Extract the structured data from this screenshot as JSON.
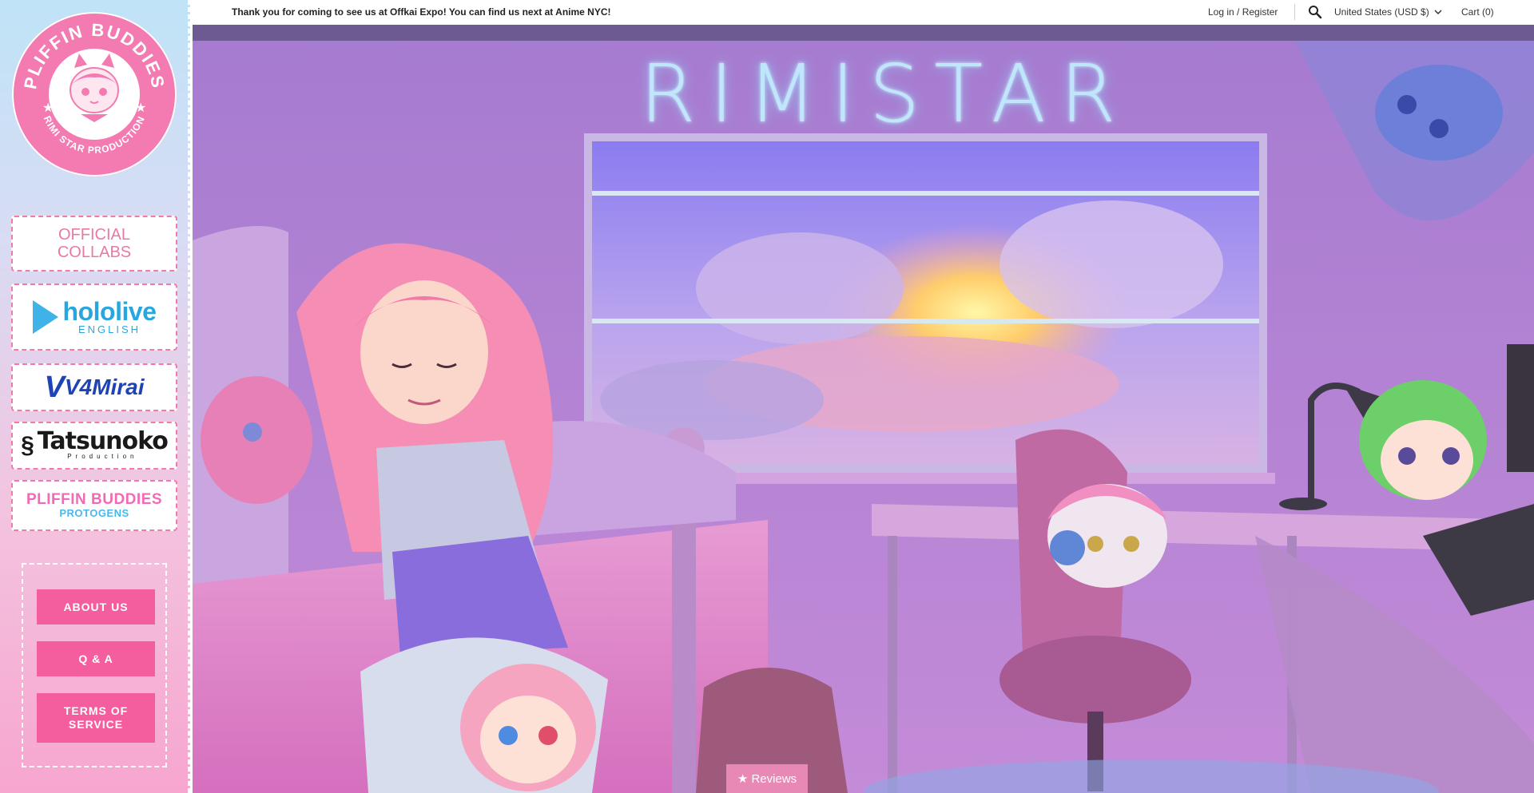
{
  "sidebar": {
    "logo": {
      "brand": "PLIFFIN BUDDIES",
      "subtitle": "RIMI STAR PRODUCTION"
    },
    "official_collabs_label": "OFFICIAL COLLABS",
    "partners": {
      "hololive": {
        "main": "hololive",
        "sub": "ENGLISH"
      },
      "v4mirai": {
        "mark": "V",
        "main": "V4Mirai"
      },
      "tatsunoko": {
        "main": "Tatsunoko",
        "sub": "Production"
      },
      "protogens": {
        "main": "PLIFFIN BUDDIES",
        "sub": "PROTOGENS"
      }
    },
    "info_buttons": {
      "about": "ABOUT US",
      "qa": "Q & A",
      "terms": "TERMS OF SERVICE"
    }
  },
  "header": {
    "announcement": "Thank you for coming to see us at Offkai Expo! You can find us next at Anime NYC!",
    "login": "Log in / Register",
    "currency": "United States (USD $)",
    "cart": "Cart (0)"
  },
  "hero": {
    "title": "RIMISTAR"
  },
  "reviews_tab": "★ Reviews",
  "colors": {
    "accent_pink": "#f55e9e",
    "logo_pink": "#f37bb1",
    "hero_purple": "#b78ad6"
  },
  "icons": [
    "search-icon",
    "chevron-down-icon",
    "star-icon"
  ]
}
